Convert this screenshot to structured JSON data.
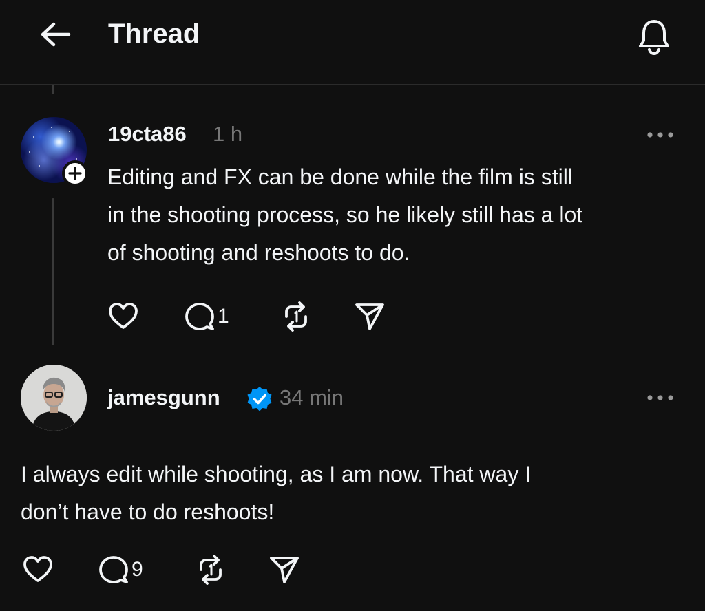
{
  "header": {
    "title": "Thread",
    "back_icon": "arrow-left-icon",
    "notify_icon": "bell-icon"
  },
  "colors": {
    "background": "#101010",
    "text_primary": "#f3f5f7",
    "text_secondary": "#777777",
    "verified_blue": "#0095f6",
    "divider": "#2b2b2b"
  },
  "posts": [
    {
      "username": "19cta86",
      "time": "1 h",
      "text_lines": [
        "Editing and FX can be done while the film is still",
        "in the shooting process, so he likely still has a lot",
        "of shooting and reshoots to do."
      ],
      "reply_count": "1",
      "follow_badge_icon": "plus-icon"
    },
    {
      "username": "jamesgunn",
      "verified": true,
      "time": "34 min",
      "text_lines": [
        "I always edit while shooting, as I am now. That way I",
        "don’t have to do reshoots!"
      ],
      "reply_count": "9"
    }
  ],
  "actions": {
    "like_icon": "heart-icon",
    "reply_icon": "comment-icon",
    "repost_icon": "repost-icon",
    "share_icon": "send-icon",
    "more_icon": "more-horizontal-icon"
  }
}
